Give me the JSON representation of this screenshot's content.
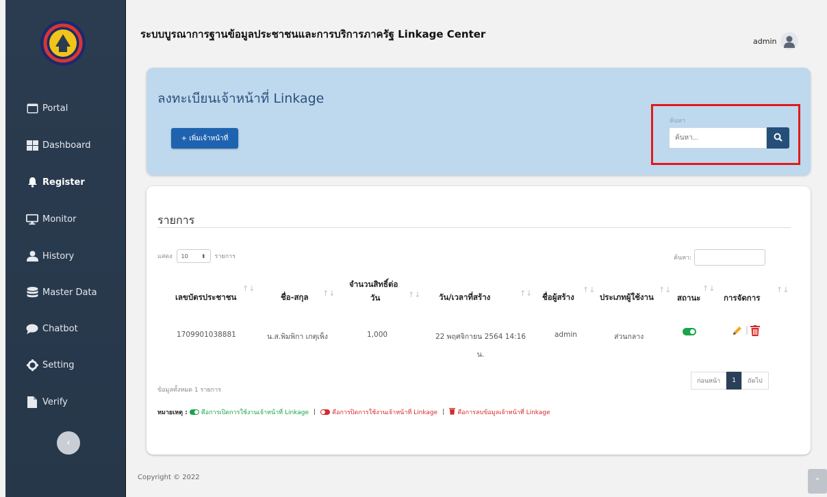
{
  "header": {
    "title": "ระบบบูรณาการฐานข้อมูลประชาชนและการบริการภาครัฐ Linkage Center",
    "user": "admin"
  },
  "sidebar": {
    "items": [
      {
        "label": "Portal",
        "icon": "window-icon"
      },
      {
        "label": "Dashboard",
        "icon": "grid-icon"
      },
      {
        "label": "Register",
        "icon": "bell-icon",
        "active": true
      },
      {
        "label": "Monitor",
        "icon": "monitor-icon"
      },
      {
        "label": "History",
        "icon": "user-icon"
      },
      {
        "label": "Master Data",
        "icon": "database-icon"
      },
      {
        "label": "Chatbot",
        "icon": "chat-icon"
      },
      {
        "label": "Setting",
        "icon": "gear-icon"
      },
      {
        "label": "Verify",
        "icon": "file-icon"
      }
    ]
  },
  "register": {
    "title": "ลงทะเบียนเจ้าหน้าที่ Linkage",
    "add_button": "+ เพิ่มเจ้าหน้าที่",
    "search_label": "ค้นหา",
    "search_placeholder": "ค้นหา..."
  },
  "list": {
    "title": "รายการ",
    "show_prefix": "แสดง",
    "page_size": "10",
    "show_suffix": "รายการ",
    "filter_label": "ค้นหา:",
    "columns": [
      "เลขบัตรประชาชน",
      "ชื่อ-สกุล",
      "จำนวนสิทธิ์ต่อ",
      "วัน",
      "วัน/เวลาที่สร้าง",
      "ชื่อผู้สร้าง",
      "ประเภทผู้ใช้งาน",
      "สถานะ",
      "การจัดการ"
    ],
    "rows": [
      {
        "id_card": "1709901038881",
        "name": "น.ส.พิมพิกา เกตุเพ็ง",
        "quota": "1,000",
        "created_line1": "22 พฤศจิกายน 2564 14:16",
        "created_line2": "น.",
        "creator": "admin",
        "user_type": "ส่วนกลาง"
      }
    ],
    "summary": "ข้อมูลทั้งหมด 1 รายการ",
    "pager": {
      "prev": "ก่อนหน้า",
      "current": "1",
      "next": "ถัดไป"
    },
    "legend": {
      "key": "หมายเหตุ :",
      "on": "คือการเปิดการใช้งานเจ้าหน้าที่ Linkage",
      "off": "คือการปิดการใช้งานเจ้าหน้าที่ Linkage",
      "delete": "คือการลบข้อมูลเจ้าหน้าที่ Linkage"
    }
  },
  "footer": {
    "copyright": "Copyright © 2022"
  },
  "colors": {
    "sidebar": "#2b3c50",
    "panel": "#bed8ee",
    "primary": "#1f63b0",
    "highlight": "#e11a1a",
    "toggle_on": "#1aa34a",
    "danger": "#d52b2b"
  }
}
